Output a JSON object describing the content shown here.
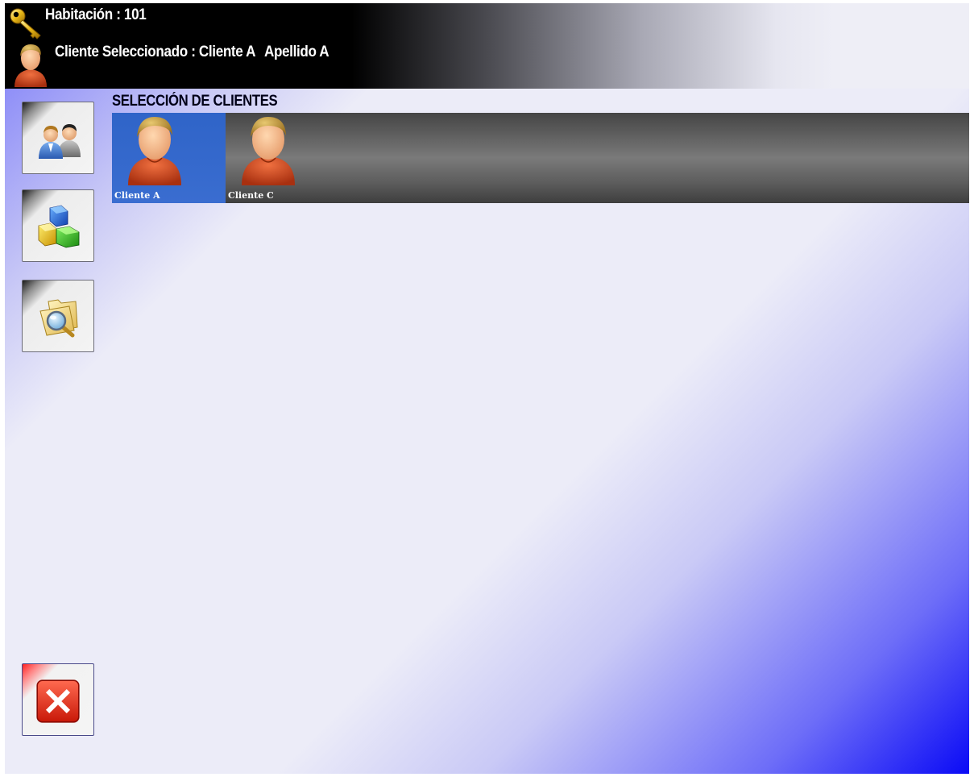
{
  "header": {
    "room_label": "Habitación : 101",
    "client_selected_label": "Cliente Seleccionado : Cliente A",
    "client_surname": "Apellido A",
    "icons": {
      "key": "key-icon",
      "client": "client-avatar-icon"
    }
  },
  "sidebar": {
    "buttons": [
      {
        "name": "clients-button",
        "icon": "users-icon"
      },
      {
        "name": "products-button",
        "icon": "cubes-icon"
      },
      {
        "name": "search-button",
        "icon": "folder-search-icon"
      },
      {
        "name": "close-button",
        "icon": "close-icon"
      }
    ]
  },
  "client_selection": {
    "title": "SELECCIÓN DE CLIENTES",
    "clients": [
      {
        "label": "Cliente A",
        "selected": true,
        "icon": "client-avatar-icon"
      },
      {
        "label": "Cliente C",
        "selected": false,
        "icon": "client-avatar-icon"
      }
    ]
  },
  "colors": {
    "selected_tile": "#2f64c8",
    "header_bg": "#000000",
    "close_red": "#e8302a"
  }
}
